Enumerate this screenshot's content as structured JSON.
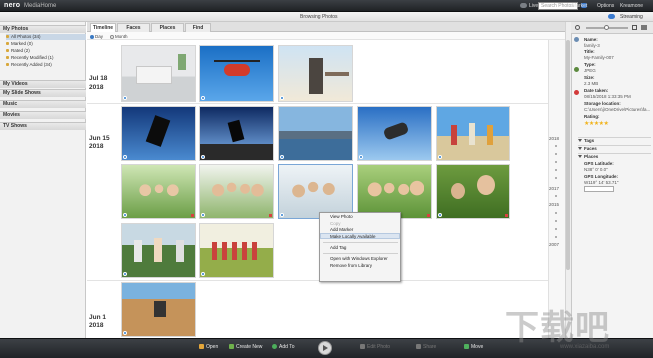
{
  "topbar": {
    "logo": "nero",
    "app_title": "MediaHome",
    "links": [
      "Live Guide",
      "Market",
      "Options",
      "Kreamone"
    ],
    "search_placeholder": "Search Photos"
  },
  "secondary": {
    "title": "Browsing Photos",
    "stream": "Streaming"
  },
  "sidebar": {
    "sections": [
      {
        "label": "My Photos",
        "items": [
          "All Photos (34)",
          "Marked (0)",
          "Rated (2)",
          "Recently Modified (1)",
          "Recently Added (34)"
        ]
      },
      {
        "label": "My Videos",
        "items": []
      },
      {
        "label": "My Slide Shows",
        "items": []
      },
      {
        "label": "Music",
        "items": []
      },
      {
        "label": "Movies",
        "items": []
      },
      {
        "label": "TV Shows",
        "items": []
      }
    ]
  },
  "tabs": [
    "Timeline",
    "Faces",
    "Places",
    "Find"
  ],
  "view_options": [
    "Day",
    "Month"
  ],
  "groups": [
    {
      "month": "Jul 18",
      "year": "2018"
    },
    {
      "month": "Jun 15",
      "year": "2018"
    },
    {
      "month": "Jun 1",
      "year": "2018"
    }
  ],
  "timeline": {
    "years": [
      "2018",
      "2017",
      "2015",
      "2007"
    ]
  },
  "details": {
    "name_label": "Name:",
    "name_value": "family-3",
    "title_label": "Title:",
    "title_value": "My-Family-007",
    "type_label": "Type:",
    "type_value": "JPEG",
    "size_label": "Size:",
    "size_value": "2.3 MB",
    "date_label": "Date taken:",
    "date_value": "08/15/2018 1:33:35 PM",
    "storage_label": "Storage location:",
    "storage_value": "C:\\Users\\j\\OneDrive\\Pictures\\fa...",
    "rating_label": "Rating:",
    "rating_value": 5,
    "sections": [
      "Tags",
      "Faces",
      "Places"
    ],
    "gps_lat_label": "GPS Latitude:",
    "gps_lat_value": "N38° 0' 0.0\"",
    "gps_long_label": "GPS Longitude:",
    "gps_long_value": "W119° 14' 53.71\""
  },
  "context_menu": {
    "items": [
      "View Photo",
      "Copy",
      "Add Marker",
      "Make Locally Available",
      "Add Tag",
      "Open with Windows Explorer",
      "Remove from Library"
    ],
    "highlighted": "Make Locally Available"
  },
  "bottombar": {
    "buttons": [
      "Open",
      "Create New",
      "Add To",
      "Edit Photo",
      "Share",
      "Move"
    ]
  },
  "watermark": "下载吧",
  "watermark_sub": "www.xiazaiba.com",
  "colors": {
    "accent": "#2e7fd0",
    "selection": "#c9d7e6",
    "star": "#f1b31c"
  }
}
